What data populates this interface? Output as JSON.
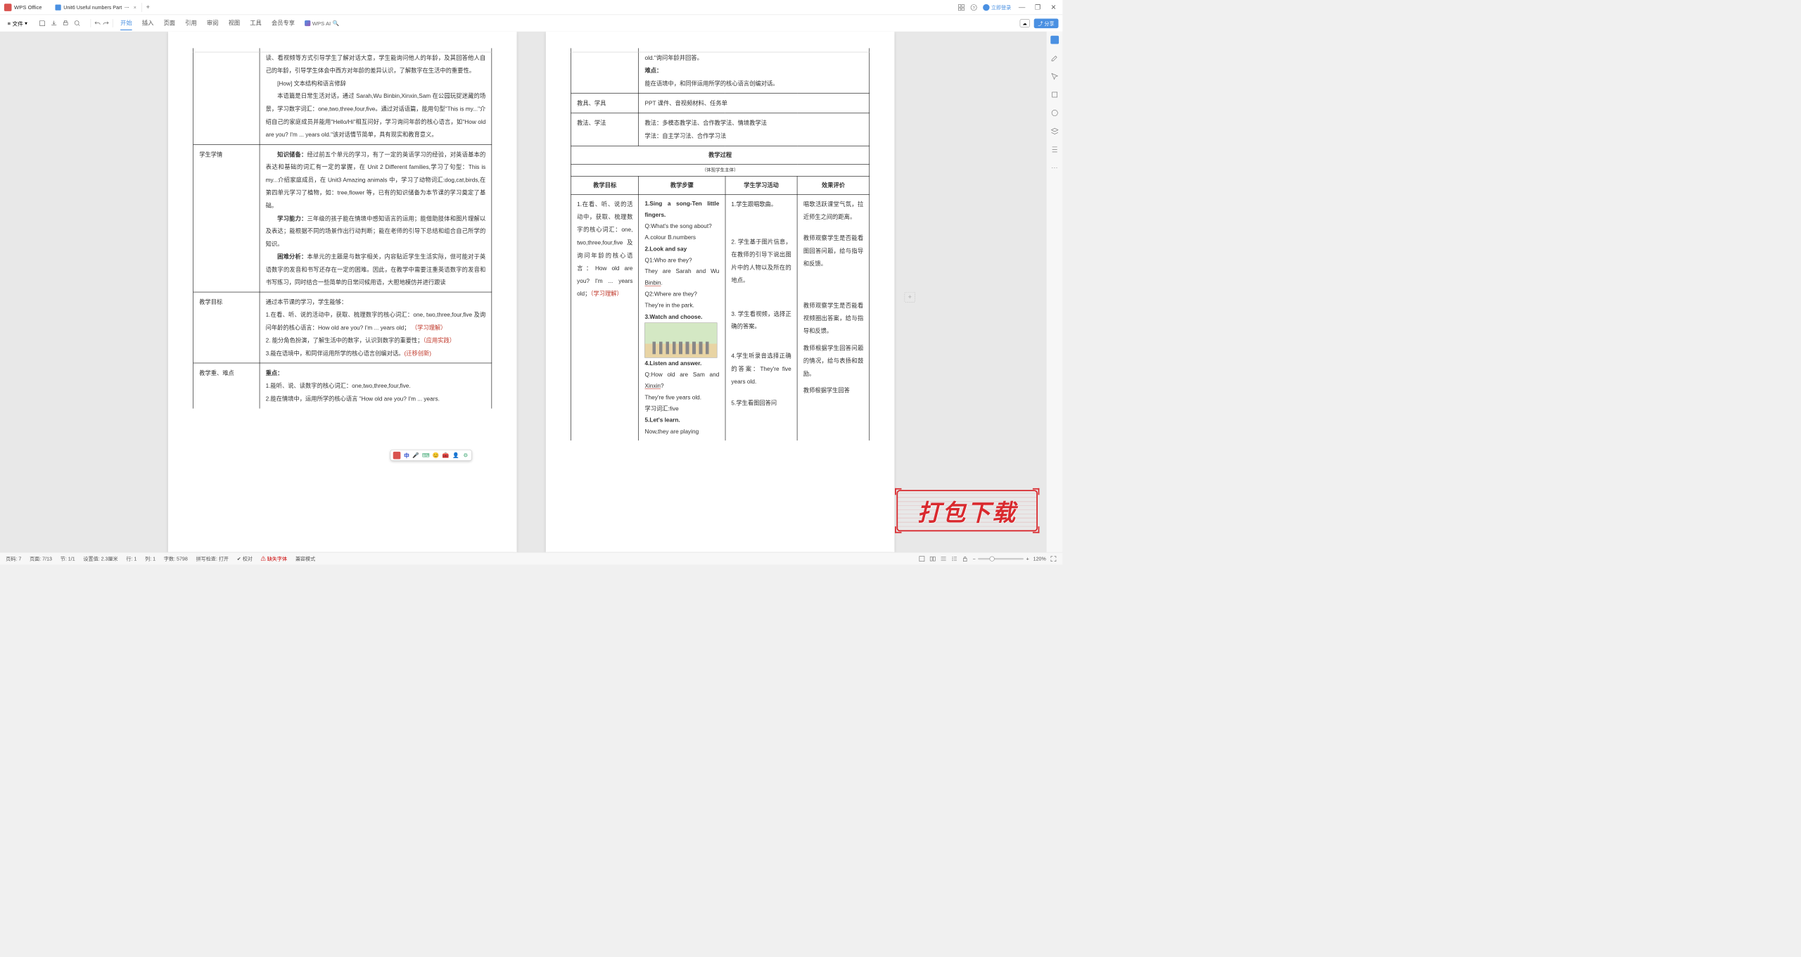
{
  "titlebar": {
    "app_name": "WPS Office",
    "tab_name": "Unit6 Useful numbers Part",
    "tab_close": "×",
    "tab_add": "+",
    "login": "立即登录"
  },
  "menubar": {
    "file": "文件",
    "tabs": [
      "开始",
      "插入",
      "页面",
      "引用",
      "审阅",
      "视图",
      "工具",
      "会员专享"
    ],
    "ai": "WPS AI",
    "share": "分享"
  },
  "page1": {
    "row1": "读、看视频等方式引导学生了解对话大意，学生能询问他人的年龄，及其回答他人自己的年龄，引导学生体会中西方对年龄的差异认识，了解数字在生活中的重要性。",
    "how_label": "[How] 文本结构和语言修辞",
    "how_body": "本语篇是日常生活对话，通过 Sarah,Wu Binbin,Xinxin,Sam 在公园玩捉迷藏的场景，学习数字词汇：one,two,three,four,five。通过对话语篇，能用句型\"This is my...\"介绍自己的家庭成员并能用\"Hello/Hi\"相互问好，学习询问年龄的核心语言，如\"How old are you? I'm ... years old.\"该对话情节简单，具有现实和教育意义。",
    "student_label": "学生学情",
    "knowledge_label": "知识储备：",
    "knowledge_body": "经过前五个单元的学习，有了一定的英语学习的经验，对英语基本的表达和基础的词汇有一定的掌握，在 Unit 2 Different families,学习了句型：This is my...介绍家庭成员，在 Unit3 Amazing animals 中，学习了动物词汇:dog,cat,birds,在第四单元学习了植物，如：tree,flower 等，已有的知识储备为本节课的学习奠定了基础。",
    "ability_label": "学习能力：",
    "ability_body": "三年级的孩子能在情境中感知语言的运用；能借助肢体和图片理解以及表达；能根据不同的场景作出行动判断；能在老师的引导下总结和组合自己所学的知识。",
    "difficulty_label": "困难分析：",
    "difficulty_body": "本单元的主题是与数字相关，内容贴近学生生活实际，但可能对于英语数字的发音和书写还存在一定的困难。因此，在教学中需要注重英语数字的发音和书写练习，同时结合一些简单的日常问候用语，大胆地模仿并进行跟读",
    "goal_label": "教学目标",
    "goal_intro": "通过本节课的学习，学生能够：",
    "goal_1": "1.在看、听、说的活动中，获取、梳理数字的核心词汇：one, two,three,four,five 及询问年龄的核心语言：How old are you? I'm ... years old；",
    "goal_1_tag": "（学习理解）",
    "goal_2": "2. 能分角色扮演，了解生活中的数字，认识到数字的重要性；",
    "goal_2_tag": "（应用实践）",
    "goal_3": "3.能在语境中，和同伴运用所学的核心语言创编对话。",
    "goal_3_tag": "(迁移创新)",
    "keypoint_label": "教学重、难点",
    "keypoint_head": "重点：",
    "keypoint_1": "1.能听、说、读数字的核心词汇：one,two,three,four,five.",
    "keypoint_2": "2.能在情境中，运用所学的核心语言 \"How old are you? I'm ... years."
  },
  "page2": {
    "row0_a": "old.\"询问年龄并回答。",
    "row0_b": "难点：",
    "row0_c": "能在语境中，和同伴运用所学的核心语言创编对话。",
    "tools_label": "教具、学具",
    "tools_body": "PPT 课件、音视频材料、任务单",
    "method_label": "教法、学法",
    "method_a": "教法：多模态教学法、合作教学法、情境教学法",
    "method_b": "学法：自主学习法、合作学习法",
    "process_title": "教学过程",
    "process_sub": "（体现学生主体）",
    "th1": "教学目标",
    "th2": "教学步骤",
    "th3": "学生学习活动",
    "th4": "效果评价",
    "col1_body": "1.在看、听、说的活动中，获取、梳理数字的核心词汇：one, two,three,four,five 及询问年龄的核心语言：How old are you? I'm ... years old；",
    "col1_tag": "（学习理解）",
    "step1": "1.Sing a song-Ten little fingers.",
    "step1_q": "Q:What's the song about?",
    "step1_opt": "A.colour    B.numbers",
    "step2": "2.Look and say",
    "step2_q1": "Q1:Who are they?",
    "step2_a1a": "They are Sarah and Wu ",
    "step2_a1b": "Binbin",
    "step2_a1c": ".",
    "step2_q2": "Q2:Where are they?",
    "step2_a2": "They're in the park.",
    "step3": "3.Watch and choose.",
    "step4": "4.Listen and answer.",
    "step4_q": "Q:How old are Sam and ",
    "step4_name": "Xinxin",
    "step4_qtail": "?",
    "step4_a": "They're five years old.",
    "step4_v": "学习词汇:five",
    "step5": "5.Let's learn.",
    "step5_a": "Now,they are playing",
    "act1": "1.学生跟唱歌曲。",
    "act2": "2. 学生基于图片信息，在教师的引导下说出图片中的人物以及所在的地点。",
    "act3": "3. 学生看视频，选择正确的答案。",
    "act4": "4.学生听录音选择正确的答案：They're five years old.",
    "act5": "5.学生看图回答问",
    "eval1": "唱歌活跃课堂气氛，拉近师生之间的距离。",
    "eval2": "教师观察学生是否能看图回答问题，给与指导和反馈。",
    "eval3": "教师观察学生是否能看视频圈出答案，给与指导和反馈。",
    "eval4": "教师根据学生回答问题的情况，给与表扬和鼓励。",
    "eval5": "教师根据学生回答"
  },
  "ime": {
    "zhong": "中"
  },
  "statusbar": {
    "page": "页码: 7",
    "pages": "页面: 7/13",
    "section": "节: 1/1",
    "pos": "设置值: 2.3厘米",
    "line": "行: 1",
    "col": "列: 1",
    "words": "字数: 5798",
    "spell": "拼写检查: 打开",
    "proof": "校对",
    "missing": "缺失字体",
    "compat": "兼容模式",
    "zoom": "120%"
  },
  "watermark": "打包下载"
}
